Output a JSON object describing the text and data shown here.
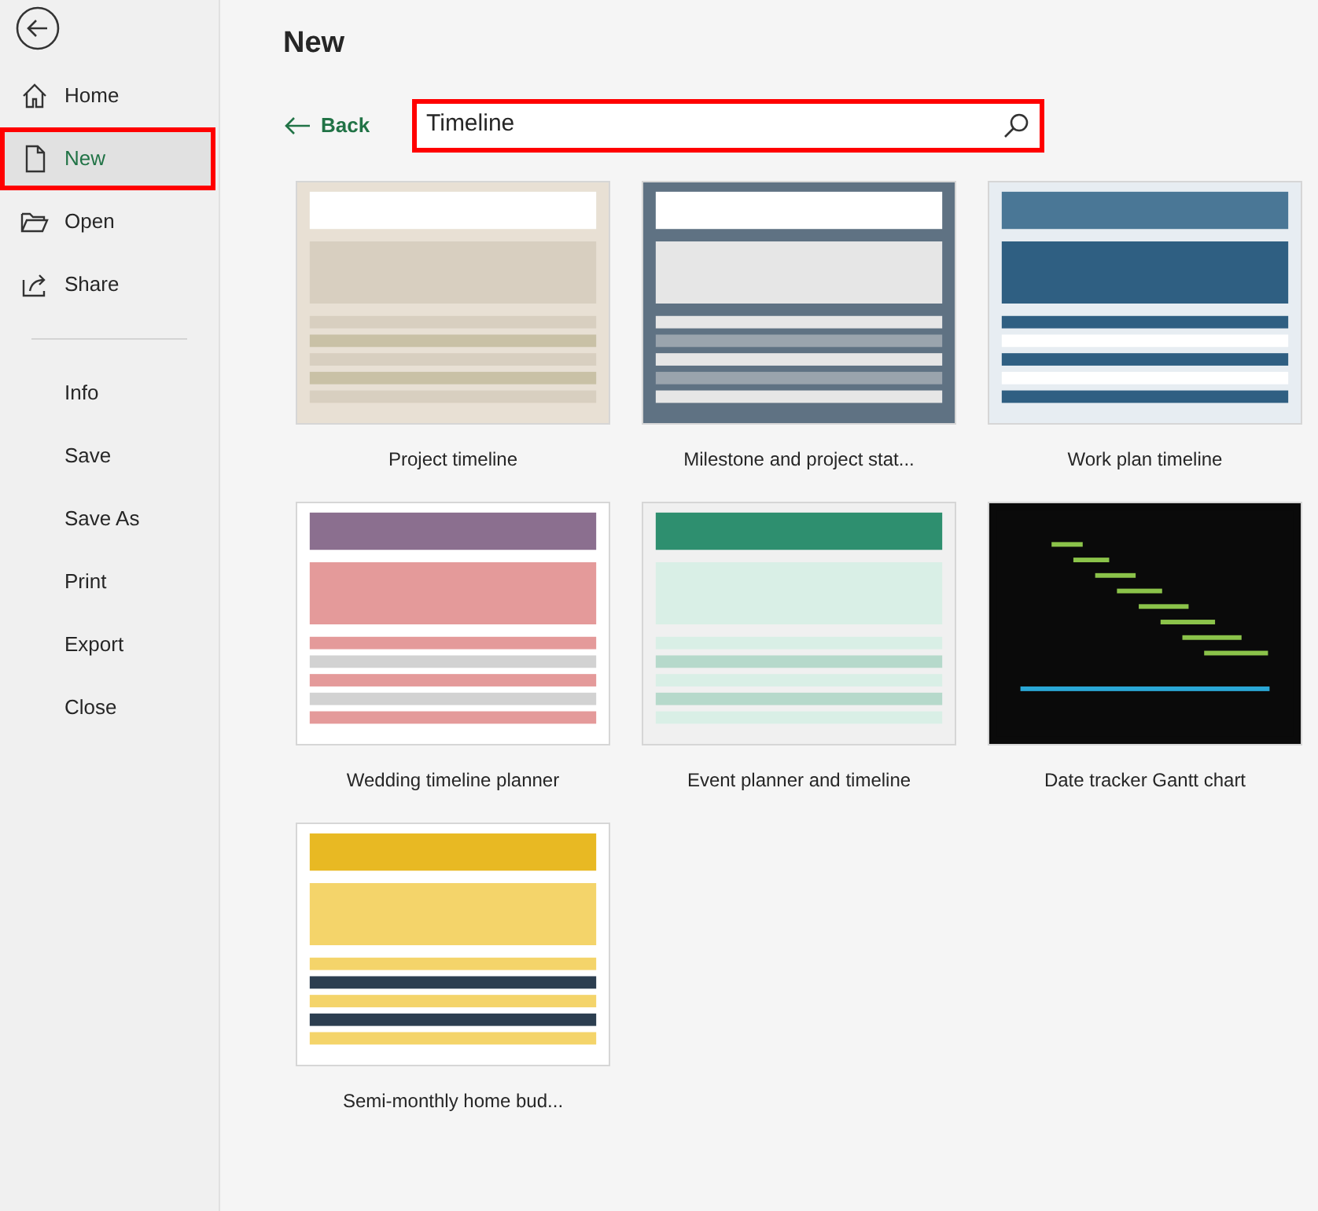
{
  "nav_items": [
    {
      "label": "Home",
      "kind": "home",
      "selected": false,
      "highlighted": false
    },
    {
      "label": "New",
      "kind": "new",
      "selected": true,
      "highlighted": true
    },
    {
      "label": "Open",
      "kind": "open",
      "selected": false,
      "highlighted": false
    },
    {
      "label": "Share",
      "kind": "share",
      "selected": false,
      "highlighted": false
    },
    {
      "label": "Info",
      "selected": false,
      "highlighted": false
    },
    {
      "label": "Save",
      "selected": false,
      "highlighted": false
    },
    {
      "label": "Save As",
      "selected": false,
      "highlighted": false
    },
    {
      "label": "Print",
      "selected": false,
      "highlighted": false
    },
    {
      "label": "Export",
      "selected": false,
      "highlighted": false
    },
    {
      "label": "Close",
      "selected": false,
      "highlighted": false
    }
  ],
  "page_title": "New",
  "back_link": "Back",
  "search": {
    "value": "Timeline",
    "highlighted": true
  },
  "templates": [
    {
      "name": "Project timeline",
      "kind": "picture"
    },
    {
      "name": "Milestone and project stat...",
      "kind": "picture"
    },
    {
      "name": "Work plan timeline",
      "kind": "picture"
    },
    {
      "name": "Wedding timeline planner",
      "kind": "picture"
    },
    {
      "name": "Event planner and timeline",
      "kind": "picture"
    },
    {
      "name": "Date tracker Gantt chart",
      "kind": "picture"
    },
    {
      "name": "Semi-monthly home bud...",
      "kind": "picture"
    }
  ]
}
